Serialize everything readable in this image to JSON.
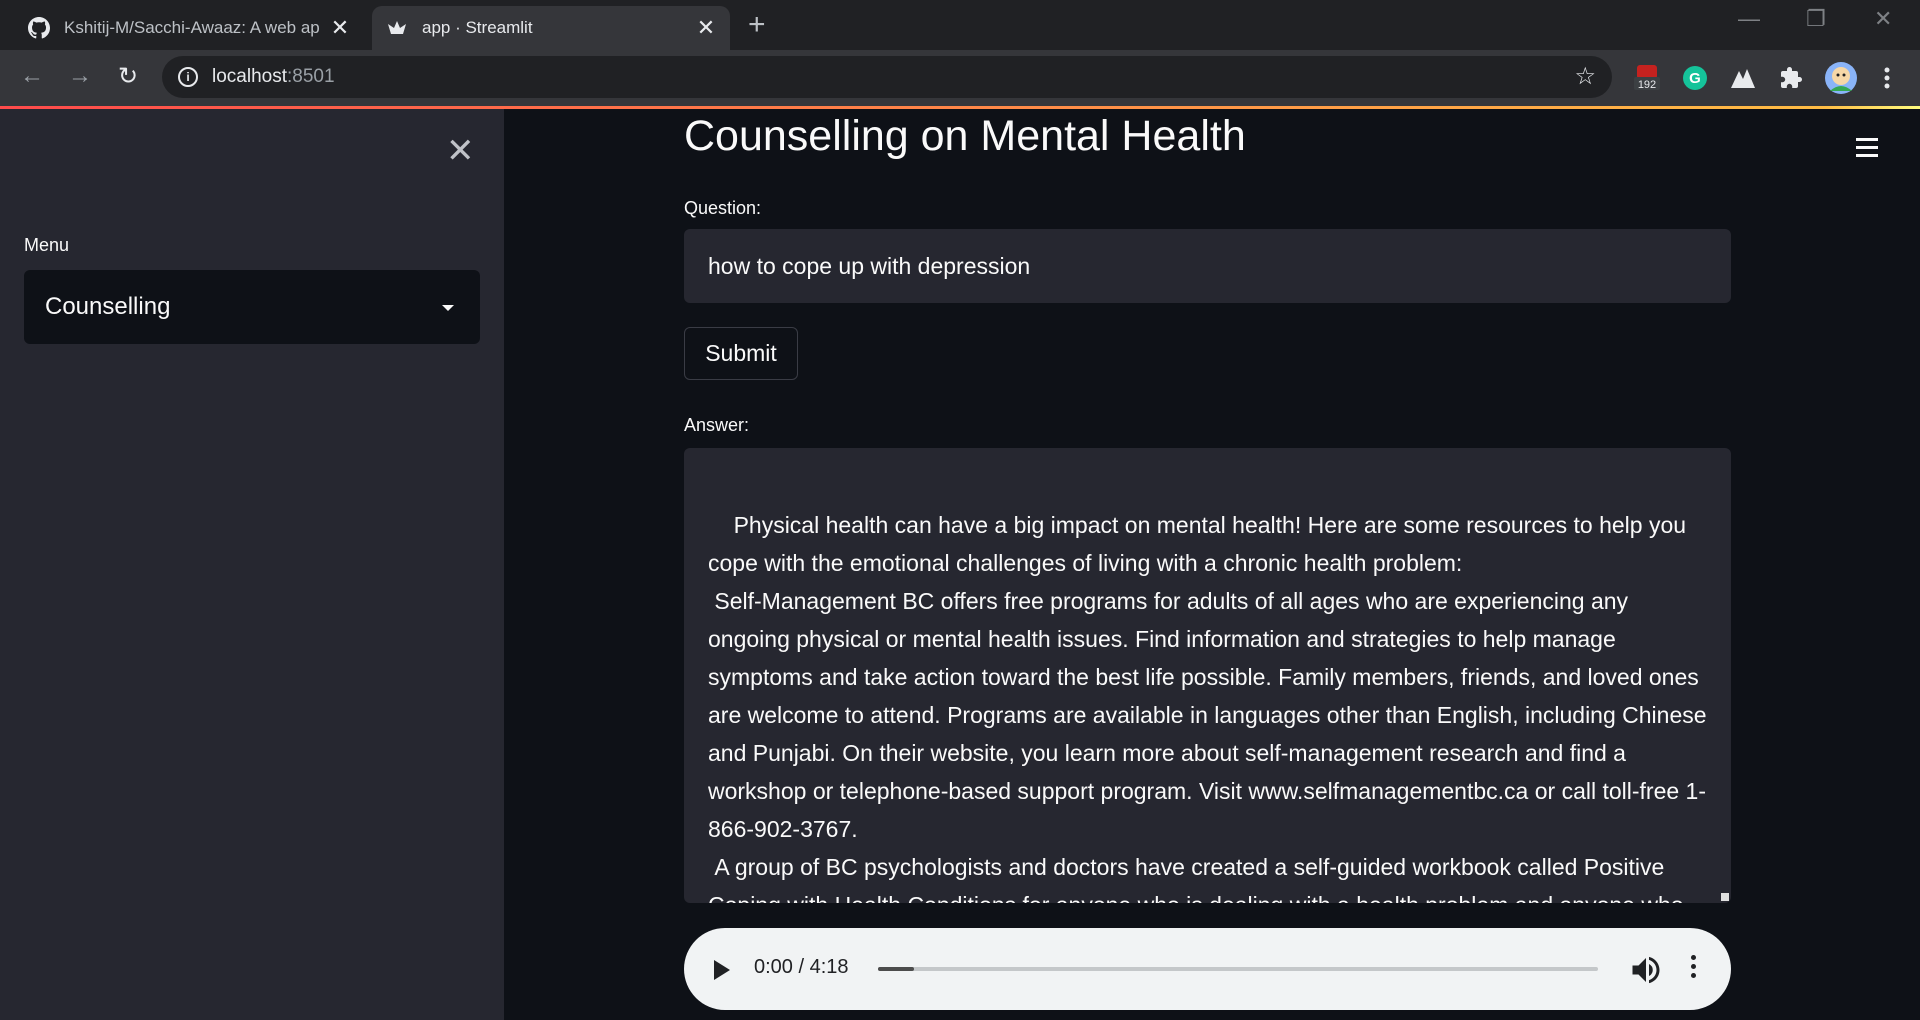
{
  "browser": {
    "tabs": [
      {
        "title": "Kshitij-M/Sacchi-Awaaz: A web ap",
        "icon": "github-icon"
      },
      {
        "title": "app · Streamlit",
        "icon": "streamlit-icon"
      }
    ],
    "url_host": "localhost",
    "url_port": ":8501",
    "extension_badge": "192"
  },
  "sidebar": {
    "menu_label": "Menu",
    "selected_option": "Counselling"
  },
  "main": {
    "title": "Counselling on Mental Health",
    "question_label": "Question:",
    "question_value": "how to cope up with depression",
    "submit_label": "Submit",
    "answer_label": "Answer:",
    "answer_text": "Physical health can have a big impact on mental health! Here are some resources to help you cope with the emotional challenges of living with a chronic health problem:\n Self-Management BC offers free programs for adults of all ages who are experiencing any ongoing physical or mental health issues. Find information and strategies to help manage symptoms and take action toward the best life possible. Family members, friends, and loved ones are welcome to attend. Programs are available in languages other than English, including Chinese and Punjabi. On their website, you learn more about self-management research and find a workshop or telephone-based support program. Visit www.selfmanagementbc.ca or call toll-free 1-866-902-3767.\n A group of BC psychologists and doctors have created a self-guided workbook called Positive Coping with Health Conditions for anyone who is dealing with a health problem and anyone who supports a loved one that experiences a health problem. The workbook",
    "audio_time": "0:00 / 4:18",
    "audio_progress": 0.05
  },
  "colors": {
    "accent_start": "#ff4b4b",
    "accent_end": "#fffd80",
    "sidebar_bg": "#262730",
    "main_bg": "#0e1117"
  }
}
